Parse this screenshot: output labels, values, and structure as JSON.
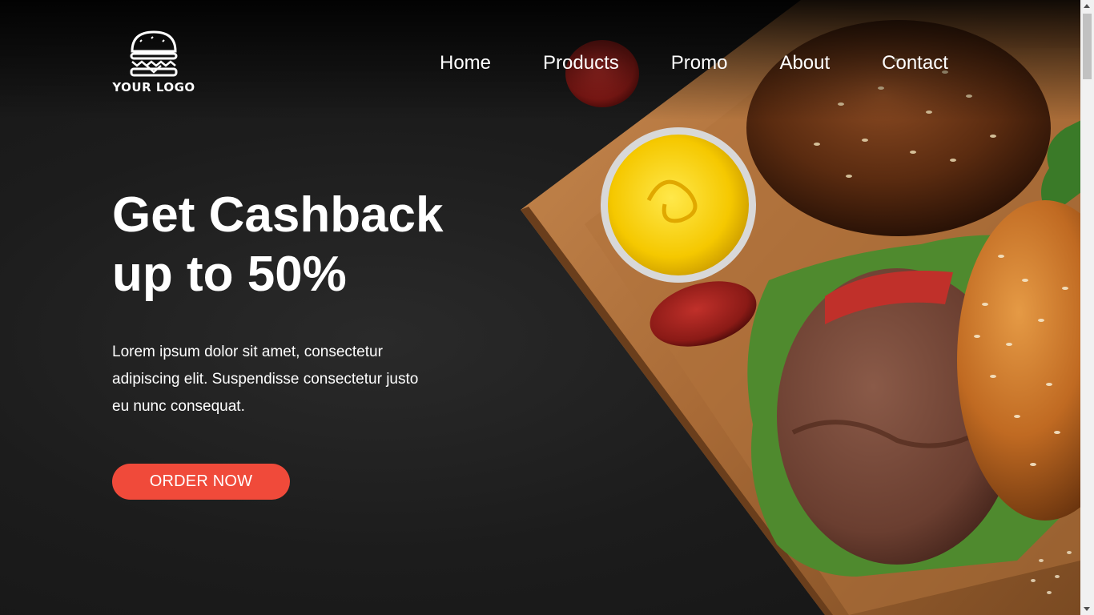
{
  "logo": {
    "text": "YOUR LOGO",
    "icon": "burger-icon"
  },
  "nav": {
    "items": [
      {
        "label": "Home"
      },
      {
        "label": "Products"
      },
      {
        "label": "Promo"
      },
      {
        "label": "About"
      },
      {
        "label": "Contact"
      }
    ]
  },
  "hero": {
    "title_line1": "Get Cashback",
    "title_line2": "up to 50%",
    "description": "Lorem ipsum dolor sit amet, consectetur adipiscing elit. Suspendisse consectetur justo eu nunc consequat.",
    "cta_label": "ORDER NOW"
  },
  "colors": {
    "background": "#1c1c1c",
    "accent": "#f04a3a",
    "text": "#ffffff"
  }
}
